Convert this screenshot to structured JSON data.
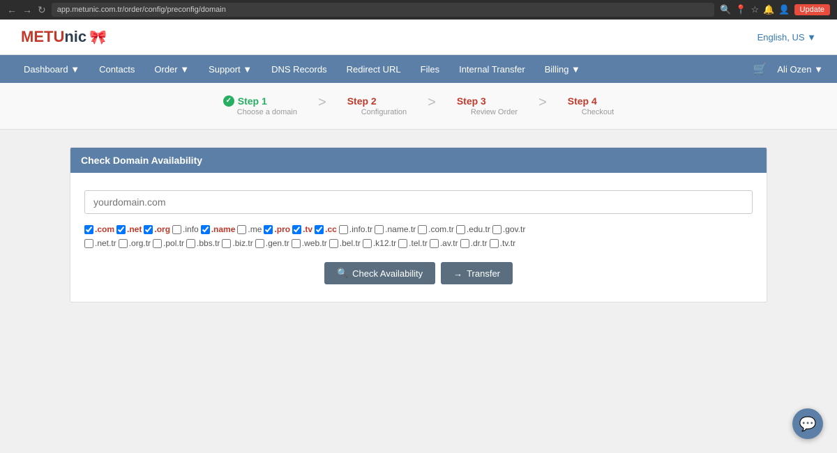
{
  "browser": {
    "url": "app.metunic.com.tr/order/config/preconfig/domain",
    "update_label": "Update"
  },
  "header": {
    "logo_metu": "METU",
    "logo_nic": "nic",
    "language": "English, US"
  },
  "navbar": {
    "items": [
      {
        "label": "Dashboard",
        "has_dropdown": true
      },
      {
        "label": "Contacts",
        "has_dropdown": false
      },
      {
        "label": "Order",
        "has_dropdown": true
      },
      {
        "label": "Support",
        "has_dropdown": true
      },
      {
        "label": "DNS Records",
        "has_dropdown": false
      },
      {
        "label": "Redirect URL",
        "has_dropdown": false
      },
      {
        "label": "Files",
        "has_dropdown": false
      },
      {
        "label": "Internal Transfer",
        "has_dropdown": false
      },
      {
        "label": "Billing",
        "has_dropdown": true
      }
    ],
    "user": "Ali Ozen"
  },
  "steps": [
    {
      "number": "1",
      "label": "Step 1",
      "subtitle": "Choose a domain",
      "state": "active"
    },
    {
      "number": "2",
      "label": "Step 2",
      "subtitle": "Configuration",
      "state": "future"
    },
    {
      "number": "3",
      "label": "Step 3",
      "subtitle": "Review Order",
      "state": "future"
    },
    {
      "number": "4",
      "label": "Step 4",
      "subtitle": "Checkout",
      "state": "future"
    }
  ],
  "panel": {
    "title": "Check Domain Availability",
    "input_placeholder": "yourdomain.com",
    "tld_row1": [
      {
        "label": ".com",
        "highlight": true
      },
      {
        "label": ".net",
        "highlight": true
      },
      {
        "label": ".org",
        "highlight": true
      },
      {
        "label": ".info",
        "highlight": false
      },
      {
        "label": ".name",
        "highlight": true
      },
      {
        "label": ".me",
        "highlight": false
      },
      {
        "label": ".pro",
        "highlight": true
      },
      {
        "label": ".tv",
        "highlight": true
      },
      {
        "label": ".cc",
        "highlight": true
      },
      {
        "label": ".info.tr",
        "highlight": false
      },
      {
        "label": ".name.tr",
        "highlight": false
      },
      {
        "label": ".com.tr",
        "highlight": false
      },
      {
        "label": ".edu.tr",
        "highlight": false
      },
      {
        "label": ".gov.tr",
        "highlight": false
      }
    ],
    "tld_row2": [
      {
        "label": ".net.tr",
        "highlight": false
      },
      {
        "label": ".org.tr",
        "highlight": false
      },
      {
        "label": ".pol.tr",
        "highlight": false
      },
      {
        "label": ".bbs.tr",
        "highlight": false
      },
      {
        "label": ".biz.tr",
        "highlight": false
      },
      {
        "label": ".gen.tr",
        "highlight": false
      },
      {
        "label": ".web.tr",
        "highlight": false
      },
      {
        "label": ".bel.tr",
        "highlight": false
      },
      {
        "label": ".k12.tr",
        "highlight": false
      },
      {
        "label": ".tel.tr",
        "highlight": false
      },
      {
        "label": ".av.tr",
        "highlight": false
      },
      {
        "label": ".dr.tr",
        "highlight": false
      },
      {
        "label": ".tv.tr",
        "highlight": false
      }
    ],
    "btn_check": "Check Availability",
    "btn_transfer": "Transfer"
  }
}
